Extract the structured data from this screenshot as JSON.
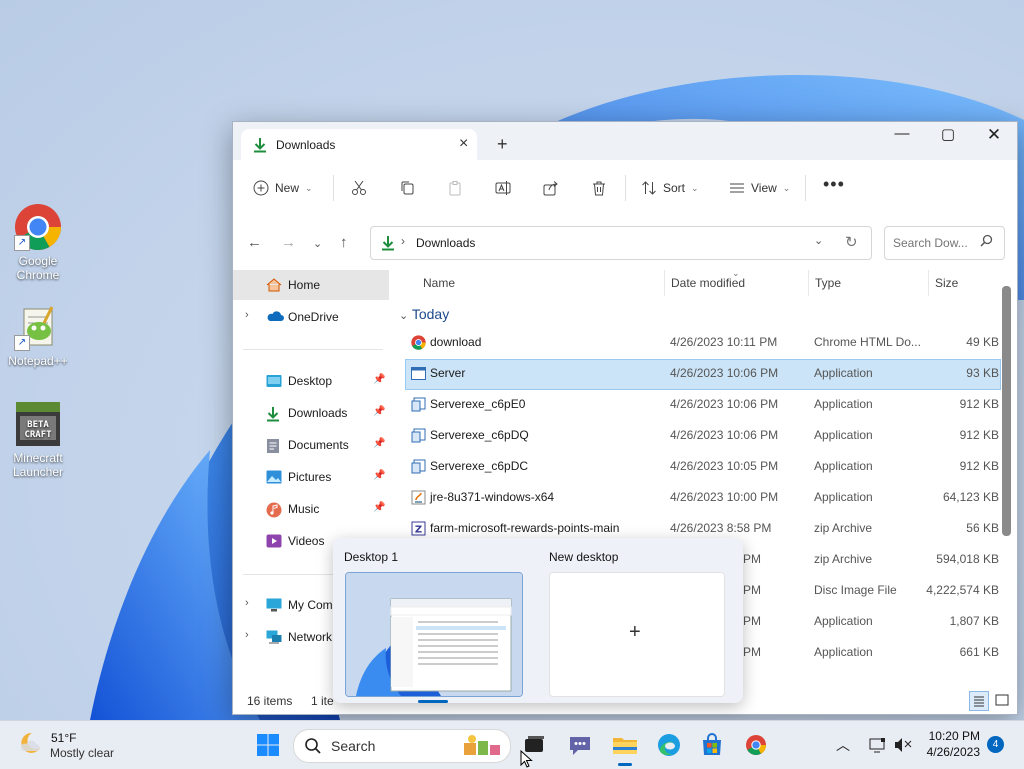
{
  "desktop": {
    "icons": [
      {
        "label": "Google Chrome"
      },
      {
        "label": "Notepad++"
      },
      {
        "label": "Minecraft Launcher"
      }
    ]
  },
  "window": {
    "tab_title": "Downloads",
    "toolbar": {
      "new_label": "New",
      "sort_label": "Sort",
      "view_label": "View"
    },
    "address": {
      "location": "Downloads",
      "search_placeholder": "Search Dow..."
    },
    "sidebar": {
      "home": "Home",
      "onedrive": "OneDrive",
      "items": [
        "Desktop",
        "Downloads",
        "Documents",
        "Pictures",
        "Music",
        "Videos"
      ],
      "my_computer": "My Com",
      "network": "Network"
    },
    "columns": [
      "Name",
      "Date modified",
      "Type",
      "Size"
    ],
    "group": "Today",
    "files": [
      {
        "name": "download",
        "date": "4/26/2023 10:11 PM",
        "type": "Chrome HTML Do...",
        "size": "49 KB"
      },
      {
        "name": "Server",
        "date": "4/26/2023 10:06 PM",
        "type": "Application",
        "size": "93 KB"
      },
      {
        "name": "Serverexe_c6pE0",
        "date": "4/26/2023 10:06 PM",
        "type": "Application",
        "size": "912 KB"
      },
      {
        "name": "Serverexe_c6pDQ",
        "date": "4/26/2023 10:06 PM",
        "type": "Application",
        "size": "912 KB"
      },
      {
        "name": "Serverexe_c6pDC",
        "date": "4/26/2023 10:05 PM",
        "type": "Application",
        "size": "912 KB"
      },
      {
        "name": "jre-8u371-windows-x64",
        "date": "4/26/2023 10:00 PM",
        "type": "Application",
        "size": "64,123 KB"
      },
      {
        "name": "farm-microsoft-rewards-points-main",
        "date": "4/26/2023 8:58 PM",
        "type": "zip Archive",
        "size": "56 KB"
      },
      {
        "name": "",
        "date": "3 PM",
        "type": "zip Archive",
        "size": "594,018 KB"
      },
      {
        "name": "",
        "date": "9 PM",
        "type": "Disc Image File",
        "size": "4,222,574 KB"
      },
      {
        "name": "",
        "date": "1 PM",
        "type": "Application",
        "size": "1,807 KB"
      },
      {
        "name": "",
        "date": "9 PM",
        "type": "Application",
        "size": "661 KB"
      }
    ],
    "status": {
      "items": "16 items",
      "selected": "1 ite"
    }
  },
  "taskview": {
    "desktop1": "Desktop 1",
    "new_desktop": "New desktop"
  },
  "taskbar": {
    "weather_temp": "51°F",
    "weather_cond": "Mostly clear",
    "search_label": "Search",
    "time": "10:20 PM",
    "date": "4/26/2023",
    "notifications": "4"
  },
  "colors": {
    "accent": "#0067c0",
    "selection": "#cce4f7",
    "download_green": "#1e8e3e"
  }
}
